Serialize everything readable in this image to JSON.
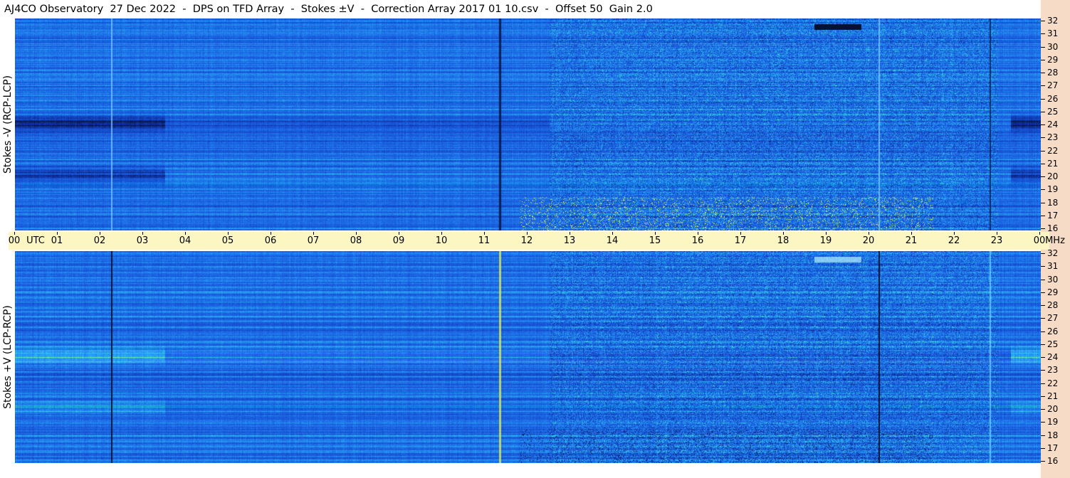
{
  "title": "AJ4CO Observatory  27 Dec 2022  -  DPS on TFD Array  -  Stokes ±V  -  Correction Array 2017 01 10.csv  -  Offset 50  Gain 2.0",
  "panels": {
    "top_label": "Stokes -V (RCP-LCP)",
    "bottom_label": "Stokes +V (LCP-RCP)"
  },
  "time_axis": {
    "ticks": [
      "00",
      "UTC",
      "01",
      "02",
      "03",
      "04",
      "05",
      "06",
      "07",
      "08",
      "09",
      "10",
      "11",
      "12",
      "13",
      "14",
      "15",
      "16",
      "17",
      "18",
      "19",
      "20",
      "21",
      "22",
      "23",
      "00",
      "MHz"
    ]
  },
  "freq_axis": {
    "labels": [
      "32",
      "31",
      "30",
      "29",
      "28",
      "27",
      "26",
      "25",
      "24",
      "23",
      "22",
      "21",
      "20",
      "19",
      "18",
      "17",
      "16"
    ]
  },
  "colors": {
    "background": "#ffffff",
    "freq_strip": "#f6dcc6",
    "time_axis_bg": "#fbf6c2",
    "spectrogram_base": "#1a5fd6"
  }
}
